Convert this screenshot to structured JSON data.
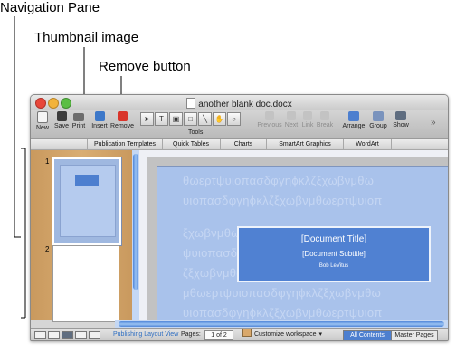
{
  "callouts": {
    "navigation_pane": "Navigation Pane",
    "thumbnail_image": "Thumbnail image",
    "remove_button": "Remove button"
  },
  "window": {
    "title": "another blank doc.docx"
  },
  "toolbar": {
    "new": "New",
    "save": "Save",
    "print": "Print",
    "insert": "Insert",
    "remove": "Remove",
    "tools": "Tools",
    "previous": "Previous",
    "next": "Next",
    "link": "Link",
    "break": "Break",
    "arrange": "Arrange",
    "group": "Group",
    "show": "Show"
  },
  "gallery_tabs": [
    "Publication Templates",
    "Quick Tables",
    "Charts",
    "SmartArt Graphics",
    "WordArt"
  ],
  "nav_pane": {
    "page_numbers": [
      "1",
      "2"
    ]
  },
  "document": {
    "title": "[Document Title]",
    "subtitle": "[Document Subtitle]",
    "author": "Bob LeVitus",
    "background_text": [
      "θωερτψυιοπασδφγηϕκλζξχωβνμθω",
      "υιοπασδφγηϕκλζξχωβνμθωερτψυιοπ",
      "ξχωβνμθω",
      "ψυιοπασδ",
      "ζξχωβνμθωερτψυιοπασδφγηϕκλζξχω",
      "μθωερτψυιοπασδφγηϕκλζξχωβνμθω",
      "υιοπασδφγηϕκλζξχωβνμθωερτψυιοπ"
    ]
  },
  "status": {
    "layout_view": "Publishing Layout View",
    "pages_label": "Pages:",
    "pages_value": "1 of 2",
    "workspace": "Customize workspace",
    "tab_all_contents": "All Contents",
    "tab_master_pages": "Master Pages"
  },
  "colors": {
    "nav_pane_wood": "#d2a366",
    "accent_blue": "#4d7fcf",
    "page_blue": "#a9c2eb",
    "remove_icon_red": "#d9352b"
  },
  "icons": {
    "new": "new-document-icon",
    "save": "floppy-disk-icon",
    "print": "printer-icon",
    "insert": "insert-page-icon",
    "remove": "remove-page-icon",
    "arrange": "arrange-icon",
    "group": "group-icon",
    "show": "show-icon"
  }
}
